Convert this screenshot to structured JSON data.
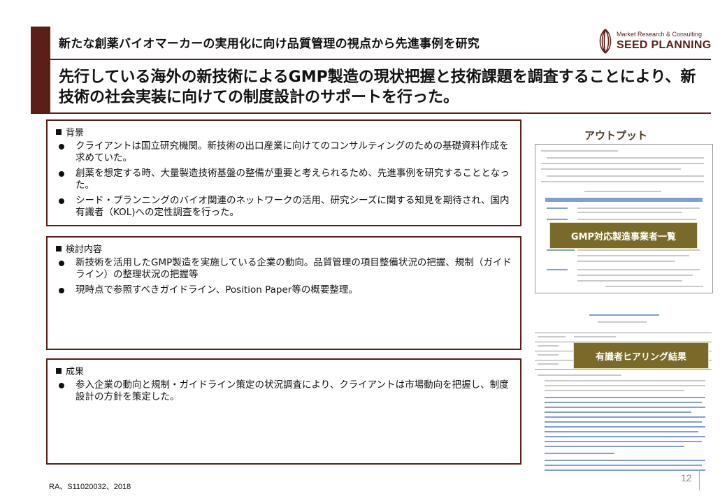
{
  "header": {
    "title_line1": "新たな創薬バイオマーカーの実用化に向け品質管理の視点から先進事例を研究",
    "title_line2": "先行している海外の新技術によるGMP製造の現状把握と技術課題を調査することにより、新技術の社会実装に向けての制度設計のサポートを行った。"
  },
  "logo": {
    "subtitle": "Market Research & Consulting",
    "name": "SEED PLANNING"
  },
  "sections": [
    {
      "heading": "背景",
      "bullets": [
        "クライアントは国立研究機関。新技術の出口産業に向けてのコンサルティングのための基礎資料作成を求めていた。",
        "創薬を想定する時、大量製造技術基盤の整備が重要と考えられるため、先進事例を研究することとなった。",
        "シード・プランニングのバイオ関連のネットワークの活用、研究シーズに関する知見を期待され、国内有識者（KOL)への定性調査を行った。"
      ]
    },
    {
      "heading": "検討内容",
      "bullets": [
        "新技術を活用したGMP製造を実施している企業の動向。品質管理の項目整備状況の把握、規制（ガイドライン）の整理状況の把握等",
        "現時点で参照すべきガイドライン、Position Paper等の概要整理。"
      ]
    },
    {
      "heading": "成果",
      "bullets": [
        "参入企業の動向と規制・ガイドライン策定の状況調査により、クライアントは市場動向を把握し、制度設計の方針を策定した。"
      ]
    }
  ],
  "output": {
    "label": "アウトプット",
    "tag1": "GMP対応製造事業者一覧",
    "tag2": "有識者ヒアリング結果"
  },
  "footer": {
    "reference": "RA、S11020032、2018",
    "page_number": "12"
  }
}
